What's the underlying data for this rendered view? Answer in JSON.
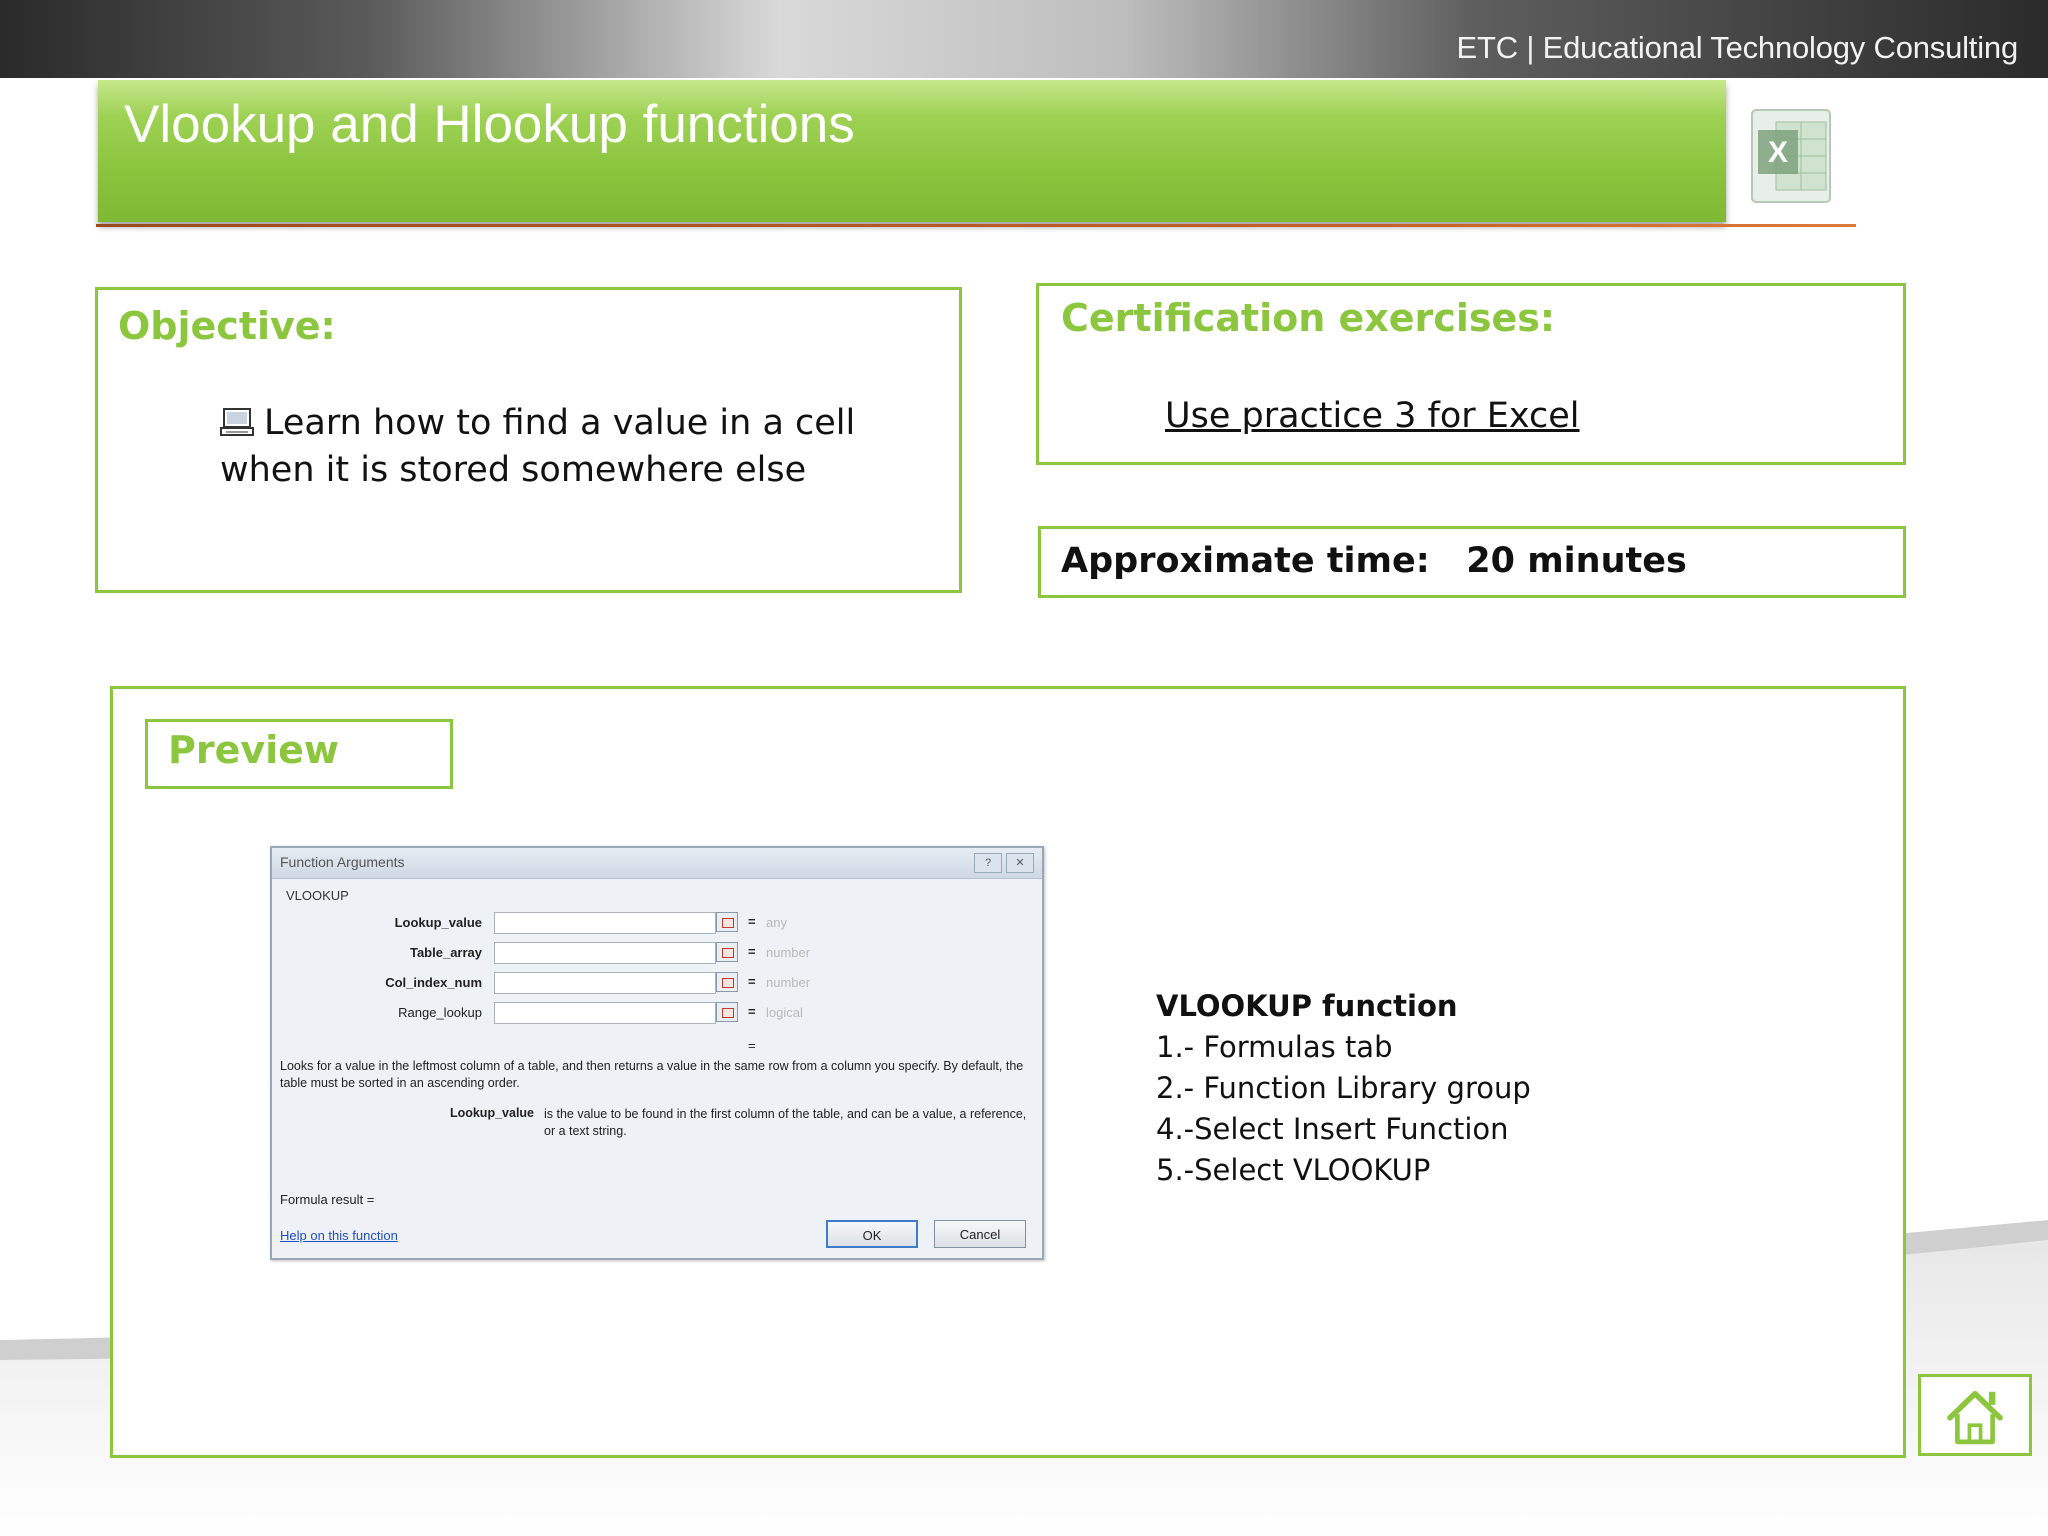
{
  "header": {
    "company": "ETC | Educational Technology Consulting",
    "title": "Vlookup and Hlookup functions"
  },
  "objective": {
    "heading": "Objective:",
    "text": "Learn how to find a value in a cell when it is stored somewhere else"
  },
  "certification": {
    "heading": "Certification exercises:",
    "link": "Use practice 3 for Excel"
  },
  "time": {
    "label": "Approximate time:   20 minutes"
  },
  "preview": {
    "heading": "Preview",
    "dialog": {
      "title": "Function Arguments",
      "function_name": "VLOOKUP",
      "args": [
        {
          "name": "Lookup_value",
          "type": "any"
        },
        {
          "name": "Table_array",
          "type": "number"
        },
        {
          "name": "Col_index_num",
          "type": "number"
        },
        {
          "name": "Range_lookup",
          "type": "logical"
        }
      ],
      "eq_mid": "=",
      "description": "Looks for a value in the leftmost column of a table, and then returns a value in the same row from a column you specify. By default, the table must be sorted in an ascending order.",
      "arg_help_name": "Lookup_value",
      "arg_help_text": "is the value to be found in the first column of the table, and can be a value, a reference, or a text string.",
      "formula_result": "Formula result =",
      "help_link": "Help on this function",
      "ok": "OK",
      "cancel": "Cancel"
    },
    "steps": {
      "heading": "VLOOKUP function",
      "items": [
        "1.- Formulas tab",
        "2.- Function Library group",
        "4.-Select Insert Function",
        "5.-Select VLOOKUP"
      ]
    }
  },
  "colors": {
    "accent_green": "#8cc63f",
    "underline_orange": "#c7612a"
  },
  "icons": {
    "objective_bullet": "laptop-icon",
    "logo": "excel-logo-icon",
    "home": "home-icon"
  }
}
